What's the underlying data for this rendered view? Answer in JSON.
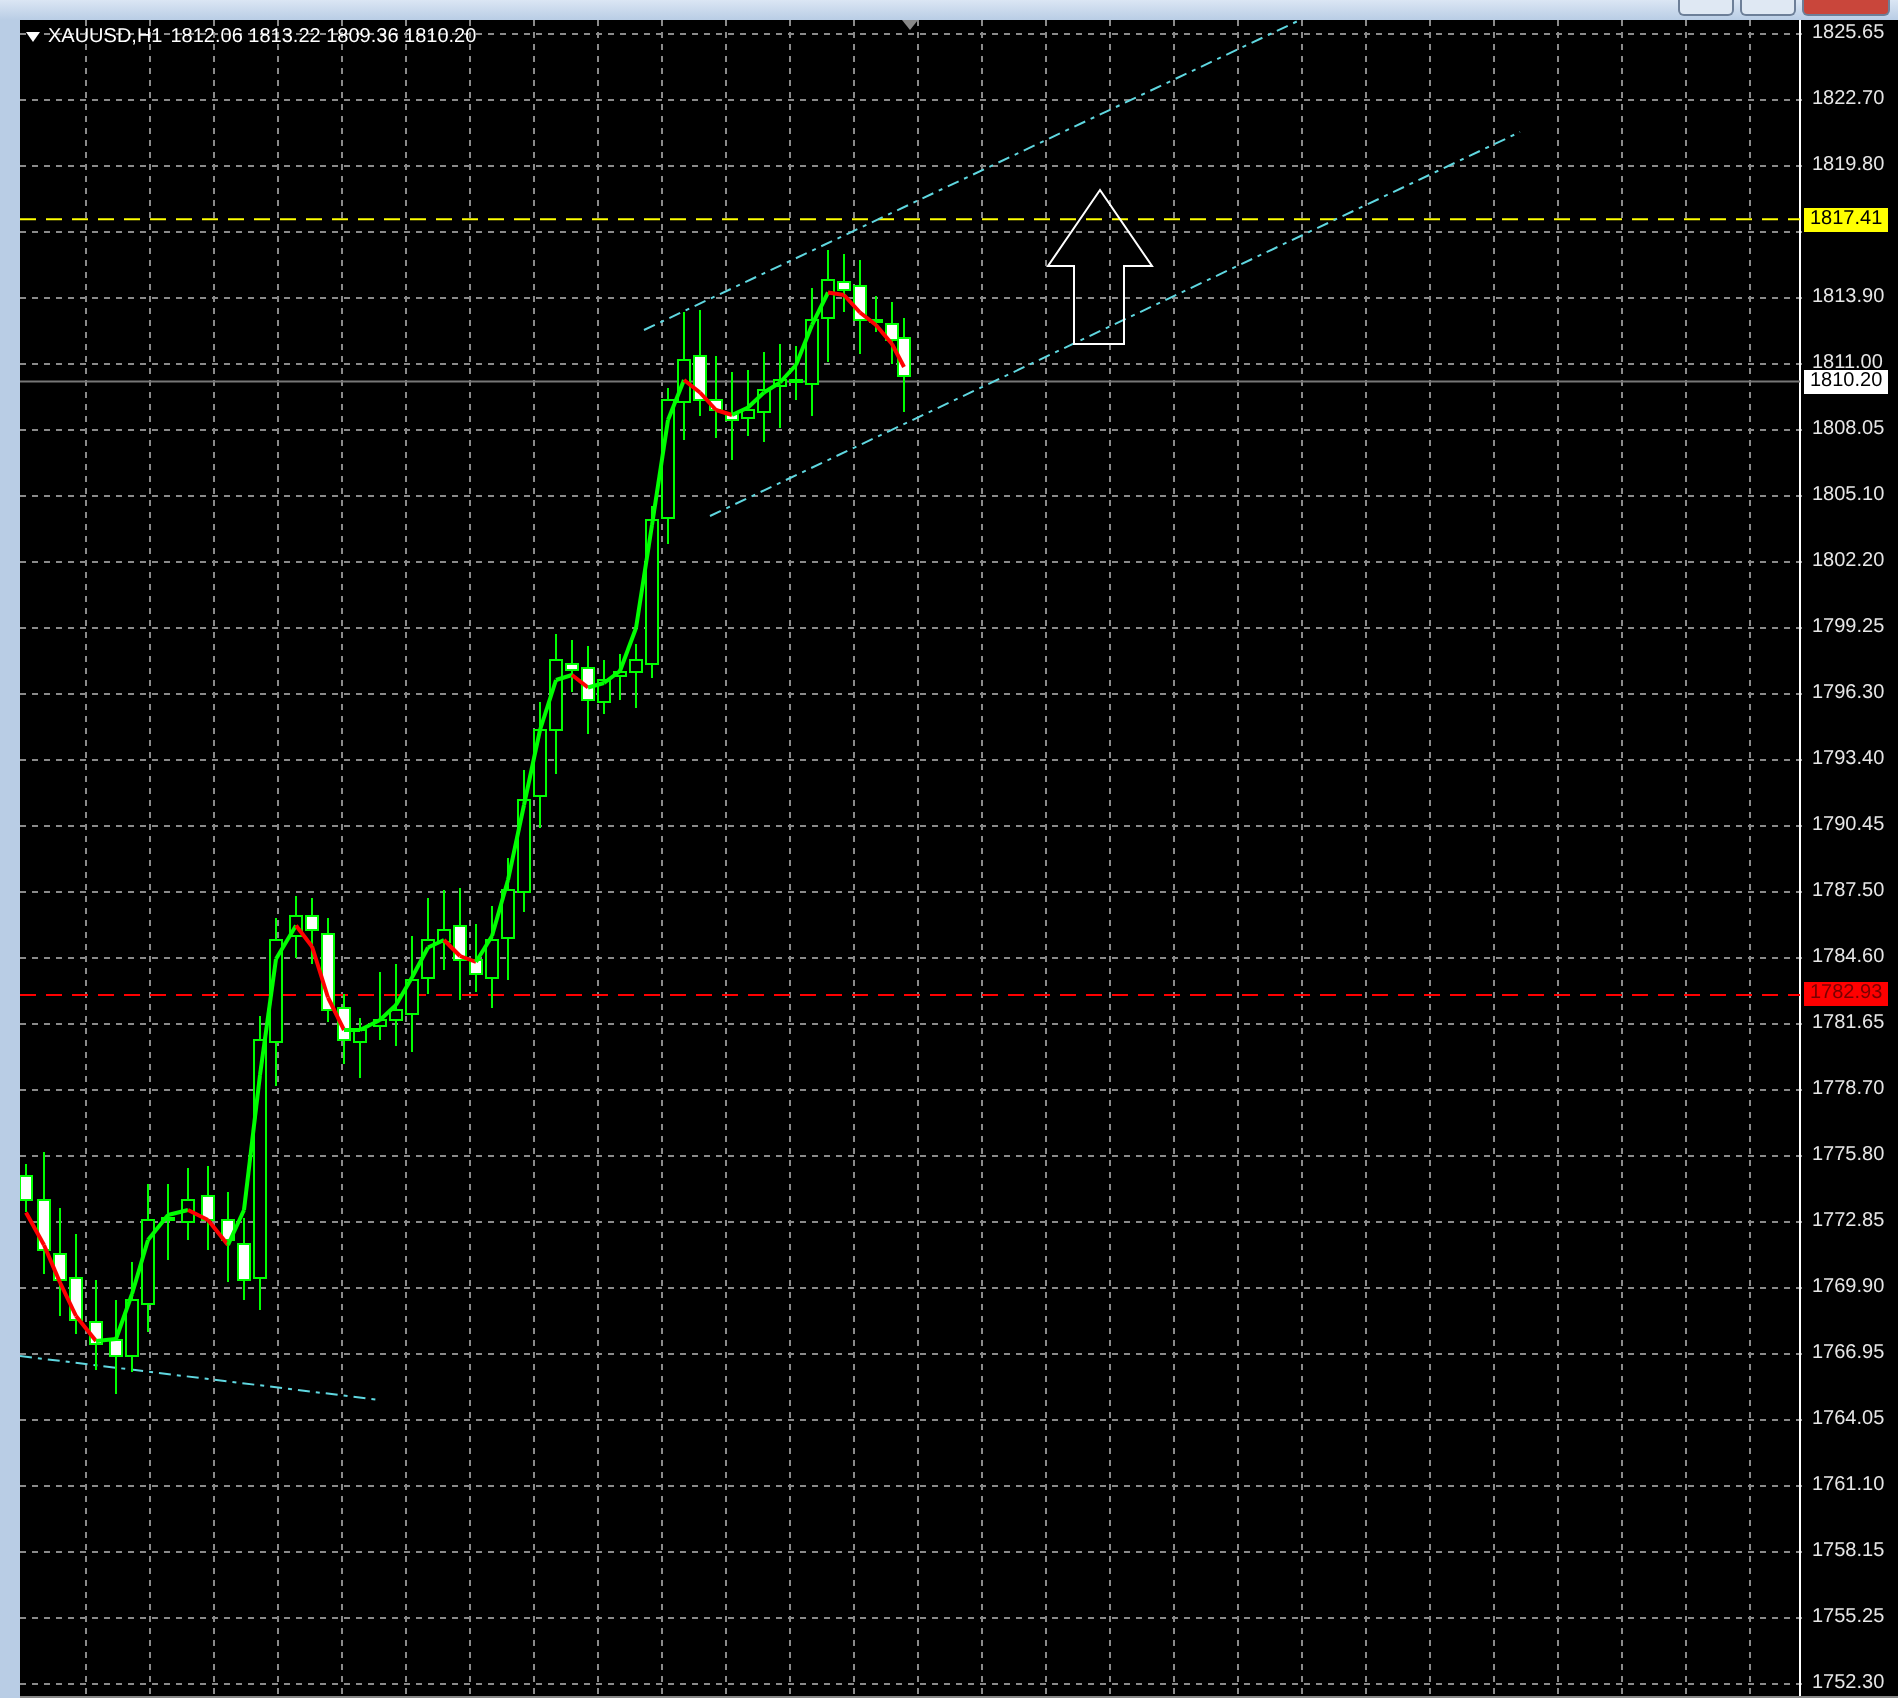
{
  "chart_header": {
    "symbol": "XAUUSD,H1",
    "ohlc": "1812.06 1813.22 1809.36 1810.20"
  },
  "price_axis": [
    "1825.65",
    "1822.70",
    "1819.80",
    "1813.90",
    "1811.00",
    "1808.05",
    "1805.10",
    "1802.20",
    "1799.25",
    "1796.30",
    "1793.40",
    "1790.45",
    "1787.50",
    "1784.60",
    "1781.65",
    "1778.70",
    "1775.80",
    "1772.85",
    "1769.90",
    "1766.95",
    "1764.05",
    "1761.10",
    "1758.15",
    "1755.25",
    "1752.30"
  ],
  "price_markers": [
    {
      "label": "1817.41",
      "kind": "level",
      "color": "#ffff00"
    },
    {
      "label": "1810.20",
      "kind": "bid",
      "color": "#ffffff"
    },
    {
      "label": "1782.93",
      "kind": "level",
      "color": "#ff0000"
    }
  ]
}
